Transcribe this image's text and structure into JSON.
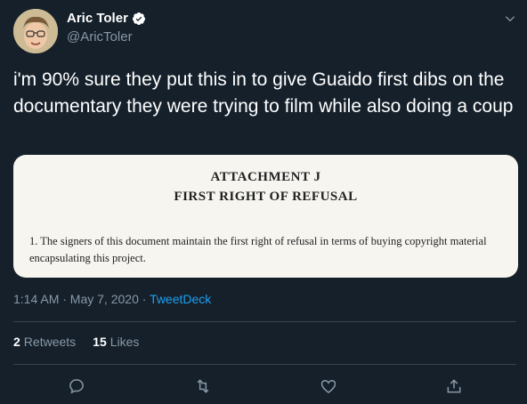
{
  "author": {
    "name": "Aric Toler",
    "handle": "@AricToler"
  },
  "tweet": {
    "text": "i'm 90% sure they put this in to give Guaido first dibs on the documentary they were trying to film while also doing a coup"
  },
  "media": {
    "heading1": "ATTACHMENT J",
    "heading2": "FIRST RIGHT OF REFUSAL",
    "body": "1. The signers of this document maintain the first right of refusal in terms of buying copyright material encapsulating this project."
  },
  "meta": {
    "timestamp": "1:14 AM · May 7, 2020 · ",
    "source": "TweetDeck"
  },
  "stats": {
    "retweets_count": "2",
    "retweets_label": "Retweets",
    "likes_count": "15",
    "likes_label": "Likes"
  },
  "icons": {
    "verified": "verified-badge-icon",
    "caret": "chevron-down-icon",
    "reply": "reply-icon",
    "retweet": "retweet-icon",
    "like": "heart-icon",
    "share": "share-icon"
  },
  "colors": {
    "background": "#15202b",
    "accent": "#1da1f2",
    "secondary_text": "#8899a6",
    "divider": "#38444d"
  }
}
